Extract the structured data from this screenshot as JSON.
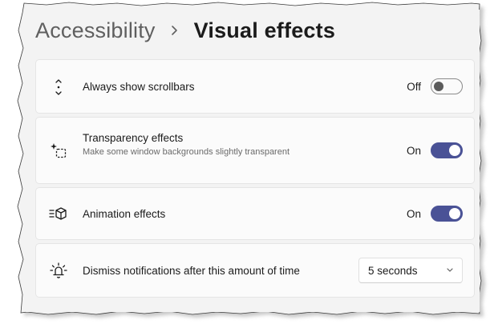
{
  "breadcrumb": {
    "parent": "Accessibility",
    "current": "Visual effects"
  },
  "settings": [
    {
      "title": "Always show scrollbars",
      "icon": "scrollbar-arrows-icon",
      "state": "Off",
      "toggle_on": false
    },
    {
      "title": "Transparency effects",
      "description": "Make some window backgrounds slightly transparent",
      "icon": "transparency-sparkle-icon",
      "state": "On",
      "toggle_on": true
    },
    {
      "title": "Animation effects",
      "icon": "animation-cube-icon",
      "state": "On",
      "toggle_on": true
    },
    {
      "title": "Dismiss notifications after this amount of time",
      "icon": "notification-bell-icon",
      "dropdown_value": "5 seconds"
    }
  ],
  "colors": {
    "accent": "#4a5296",
    "page_background": "#f3f3f3",
    "card_background": "#fbfbfb"
  }
}
